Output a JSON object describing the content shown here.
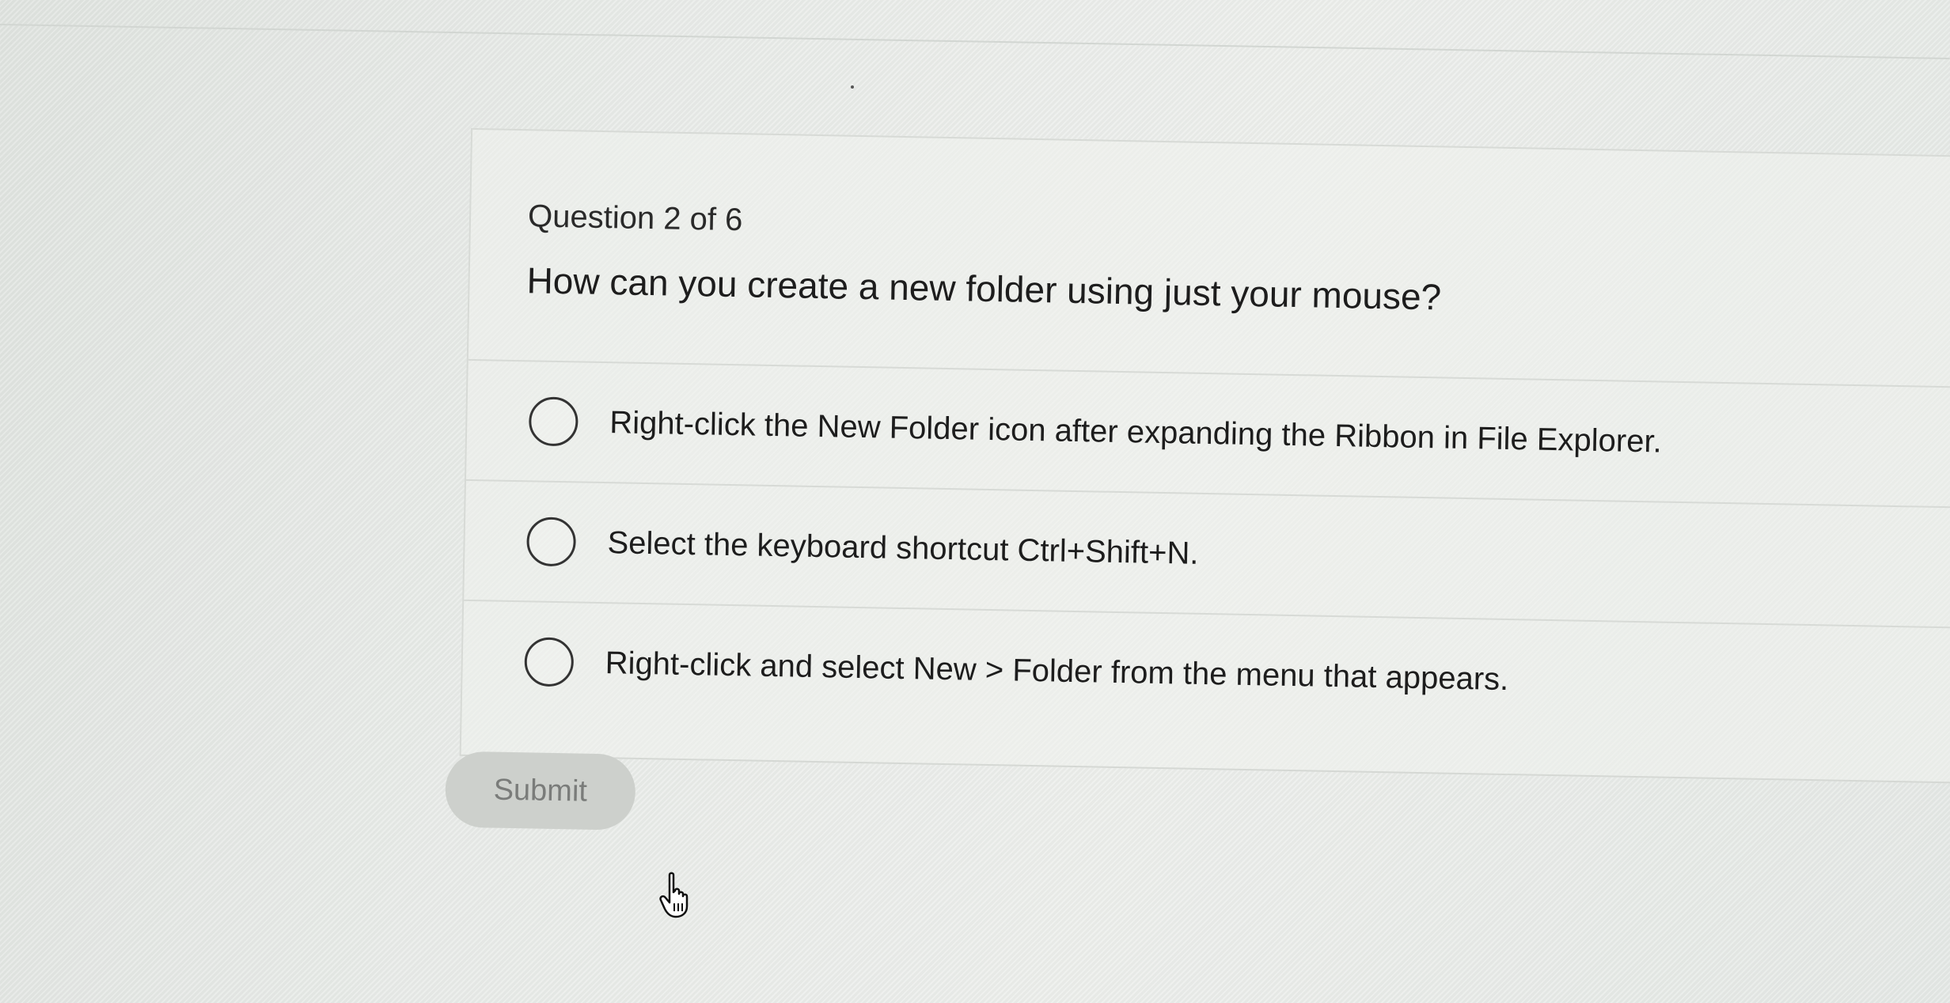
{
  "quiz": {
    "counter": "Question 2 of 6",
    "question": "How can you create a new folder using just your mouse?",
    "options": [
      {
        "label": "Right-click the New Folder icon after expanding the Ribbon in File Explorer.",
        "selected": false
      },
      {
        "label": "Select the keyboard shortcut Ctrl+Shift+N.",
        "selected": false
      },
      {
        "label": "Right-click and select New > Folder from the menu that appears.",
        "selected": false
      }
    ],
    "submit_label": "Submit",
    "submit_enabled": false
  },
  "cursor": {
    "icon": "hand-pointer-icon"
  },
  "colors": {
    "text": "#1d1d1d",
    "divider": "#d7dad6",
    "submit_bg": "#cdd0cc",
    "submit_text": "#7a7c7a"
  }
}
